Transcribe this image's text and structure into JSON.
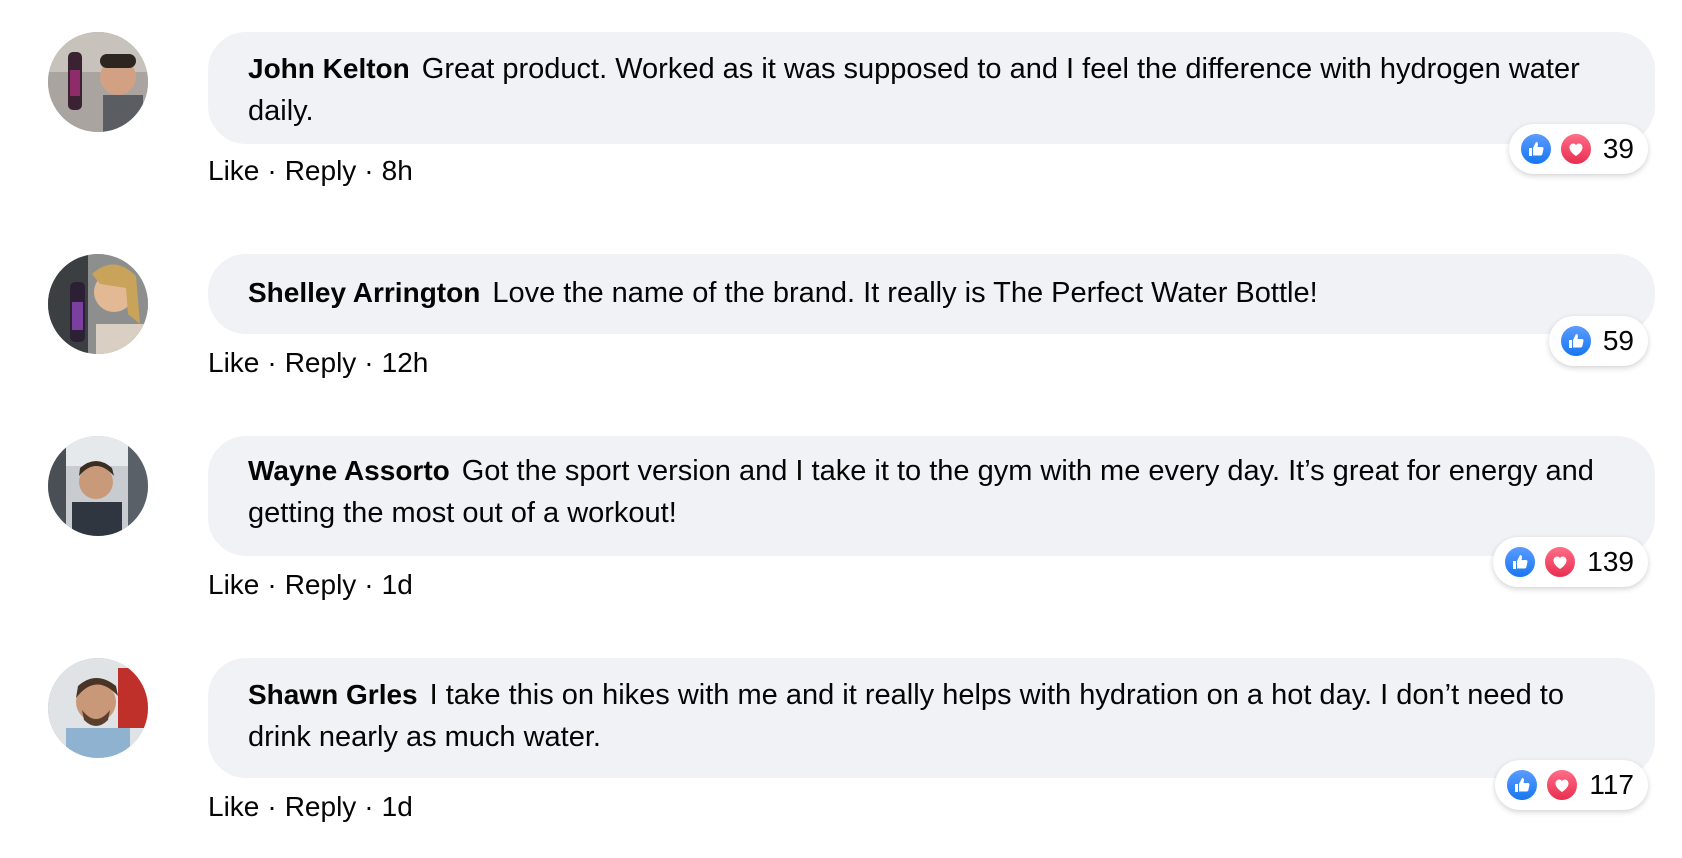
{
  "comments": [
    {
      "author": "John Kelton",
      "text": "Great product. Worked as it was supposed to and I feel the difference with hydrogen water daily.",
      "like_label": "Like",
      "reply_label": "Reply",
      "time": "8h",
      "reaction_count": "39",
      "reactions": [
        "like-icon",
        "love-icon"
      ]
    },
    {
      "author": "Shelley Arrington",
      "text": "Love the name of the brand. It really is The Perfect Water Bottle!",
      "like_label": "Like",
      "reply_label": "Reply",
      "time": "12h",
      "reaction_count": "59",
      "reactions": [
        "like-icon"
      ]
    },
    {
      "author": "Wayne Assorto",
      "text": "Got the sport version and I take it to the gym with me every day. It’s great for energy and getting the most out of a workout!",
      "like_label": "Like",
      "reply_label": "Reply",
      "time": "1d",
      "reaction_count": "139",
      "reactions": [
        "like-icon",
        "love-icon"
      ]
    },
    {
      "author": "Shawn Grles",
      "text": "I take this on hikes with me and it really helps with hydration on a hot day. I don’t need to drink nearly as much water.",
      "like_label": "Like",
      "reply_label": "Reply",
      "time": "1d",
      "reaction_count": "117",
      "reactions": [
        "like-icon",
        "love-icon"
      ]
    }
  ],
  "separator": "·",
  "colors": {
    "bubble": "#f0f2f5",
    "like": "#1877f2",
    "love": "#e82f50",
    "text": "#050505"
  }
}
